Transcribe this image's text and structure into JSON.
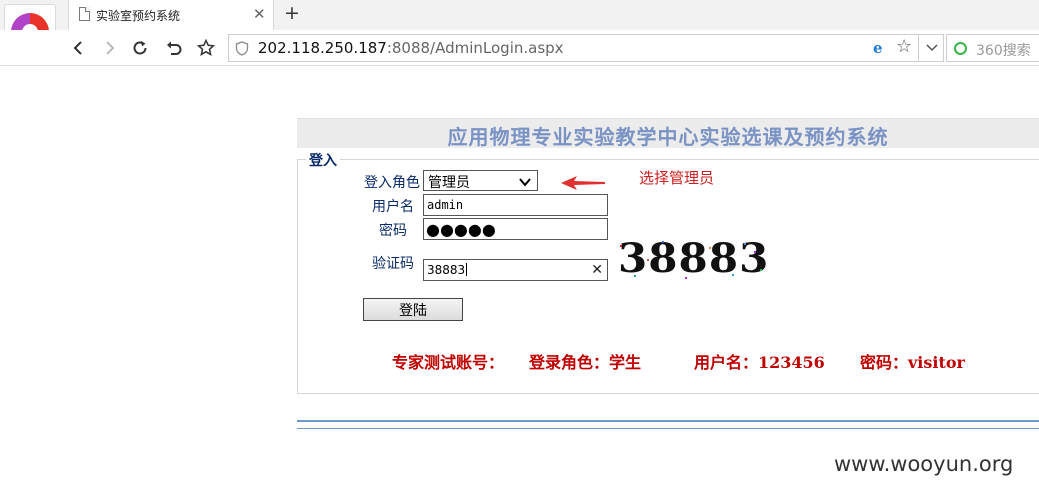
{
  "browser": {
    "tab_title": "实验室预约系统",
    "url_host": "202.118.250.187",
    "url_path": ":8088/AdminLogin.aspx",
    "search_engine": "360搜索"
  },
  "page": {
    "system_title": "应用物理专业实验教学中心实验选课及预约系统",
    "legend": "登入",
    "role_label": "登入角色",
    "role_value": "管理员",
    "username_label": "用户名",
    "username_value": "admin",
    "password_label": "密码",
    "password_mask": "●●●●●",
    "captcha_label": "验证码",
    "captcha_input": "38883",
    "captcha_image_text": "38883",
    "login_button": "登陆",
    "annotation": "选择管理员",
    "test_account": {
      "prefix": "专家测试账号：",
      "role": "登录角色：学生",
      "user": "用户名：123456",
      "password": "密码：visitor"
    }
  },
  "watermark": "www.wooyun.org",
  "colors": {
    "title_blue": "#7a93c4",
    "label_navy": "#0b2a6a",
    "alert_red": "#cc2020",
    "rule_blue": "#6f9bc6"
  }
}
